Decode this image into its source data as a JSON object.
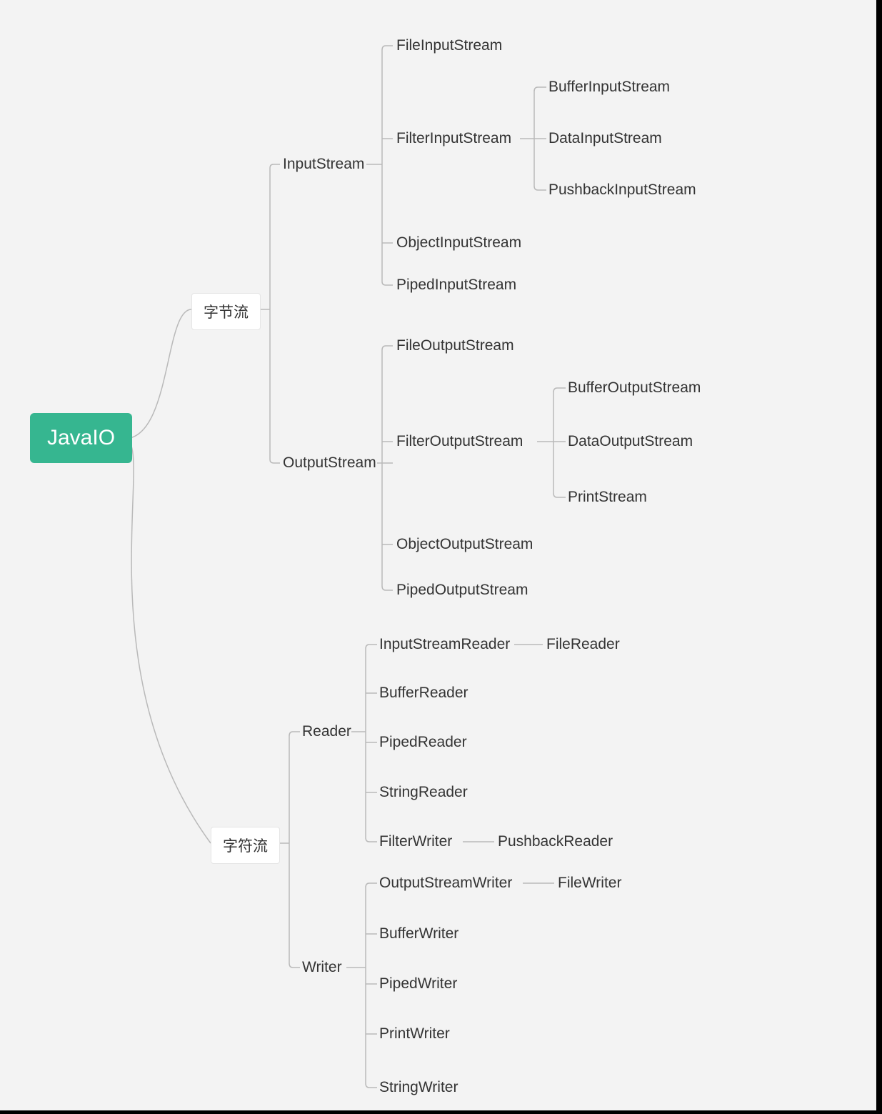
{
  "root": {
    "label": "JavaIO"
  },
  "byteStream": {
    "label": "字节流",
    "input": {
      "label": "InputStream",
      "children": {
        "file": "FileInputStream",
        "filter": "FilterInputStream",
        "object": "ObjectInputStream",
        "piped": "PipedInputStream"
      },
      "filterChildren": {
        "buffer": "BufferInputStream",
        "data": "DataInputStream",
        "pushback": "PushbackInputStream"
      }
    },
    "output": {
      "label": "OutputStream",
      "children": {
        "file": "FileOutputStream",
        "filter": "FilterOutputStream",
        "object": "ObjectOutputStream",
        "piped": "PipedOutputStream"
      },
      "filterChildren": {
        "buffer": "BufferOutputStream",
        "data": "DataOutputStream",
        "print": "PrintStream"
      }
    }
  },
  "charStream": {
    "label": "字符流",
    "reader": {
      "label": "Reader",
      "children": {
        "isr": "InputStreamReader",
        "buffer": "BufferReader",
        "piped": "PipedReader",
        "string": "StringReader",
        "filter": "FilterWriter"
      },
      "isrChild": "FileReader",
      "filterChild": "PushbackReader"
    },
    "writer": {
      "label": "Writer",
      "children": {
        "osw": "OutputStreamWriter",
        "buffer": "BufferWriter",
        "piped": "PipedWriter",
        "print": "PrintWriter",
        "string": "StringWriter"
      },
      "oswChild": "FileWriter"
    }
  }
}
